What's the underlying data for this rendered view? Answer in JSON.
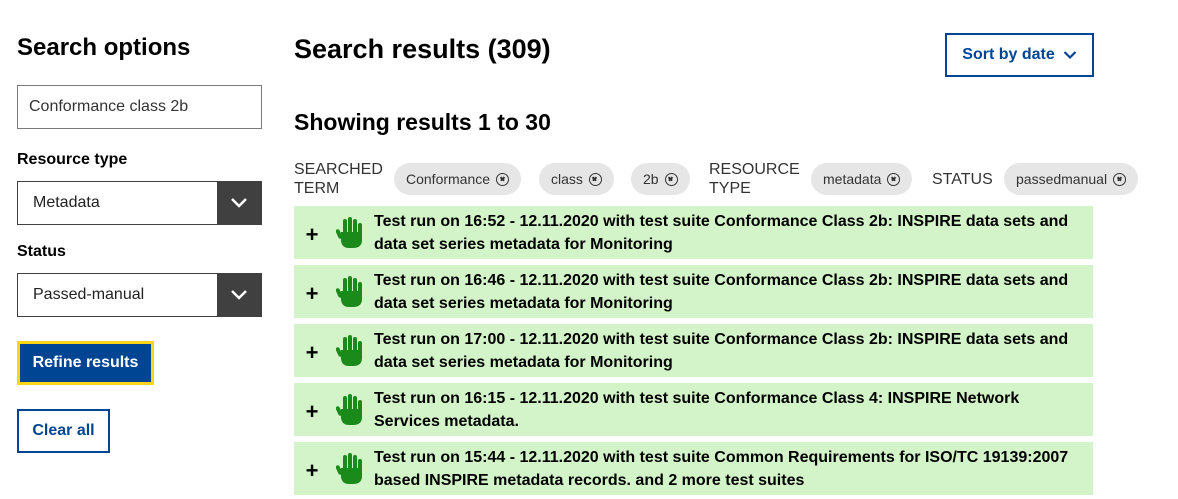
{
  "sidebar": {
    "title": "Search options",
    "search_value": "Conformance class 2b",
    "resource_type_label": "Resource type",
    "resource_type_value": "Metadata",
    "status_label": "Status",
    "status_value": "Passed-manual",
    "refine_label": "Refine results",
    "clear_label": "Clear all"
  },
  "main": {
    "results_title": "Search results (309)",
    "sort_label": "Sort by date",
    "showing": "Showing results 1 to 30",
    "filters": {
      "searched_term_label": "SEARCHED TERM",
      "term_chips": [
        "Conformance",
        "class",
        "2b"
      ],
      "resource_type_label": "RESOURCE TYPE",
      "resource_chip": "metadata",
      "status_label": "STATUS",
      "status_chip": "passedmanual"
    },
    "results": [
      {
        "line1": "Test run on 16:52 - 12.11.2020 with test suite Conformance Class 2b: INSPIRE data sets and",
        "line2": "data set series metadata for Monitoring"
      },
      {
        "line1": "Test run on 16:46 - 12.11.2020 with test suite Conformance Class 2b: INSPIRE data sets and",
        "line2": "data set series metadata for Monitoring"
      },
      {
        "line1": "Test run on 17:00 - 12.11.2020 with test suite Conformance Class 2b: INSPIRE data sets and",
        "line2": "data set series metadata for Monitoring"
      },
      {
        "line1": "Test run on 16:15 - 12.11.2020 with test suite Conformance Class 4: INSPIRE Network",
        "line2": "Services metadata."
      },
      {
        "line1": "Test run on 15:44 - 12.11.2020 with test suite Common Requirements for ISO/TC 19139:2007",
        "line2": "based INSPIRE metadata records. and 2 more test suites"
      }
    ],
    "expand_symbol": "+",
    "result_icon": "green-hand-icon",
    "colors": {
      "result_bg": "#d3f3c8",
      "primary": "#004494",
      "focus": "#ffd617",
      "hand": "#1a8a1a"
    }
  }
}
